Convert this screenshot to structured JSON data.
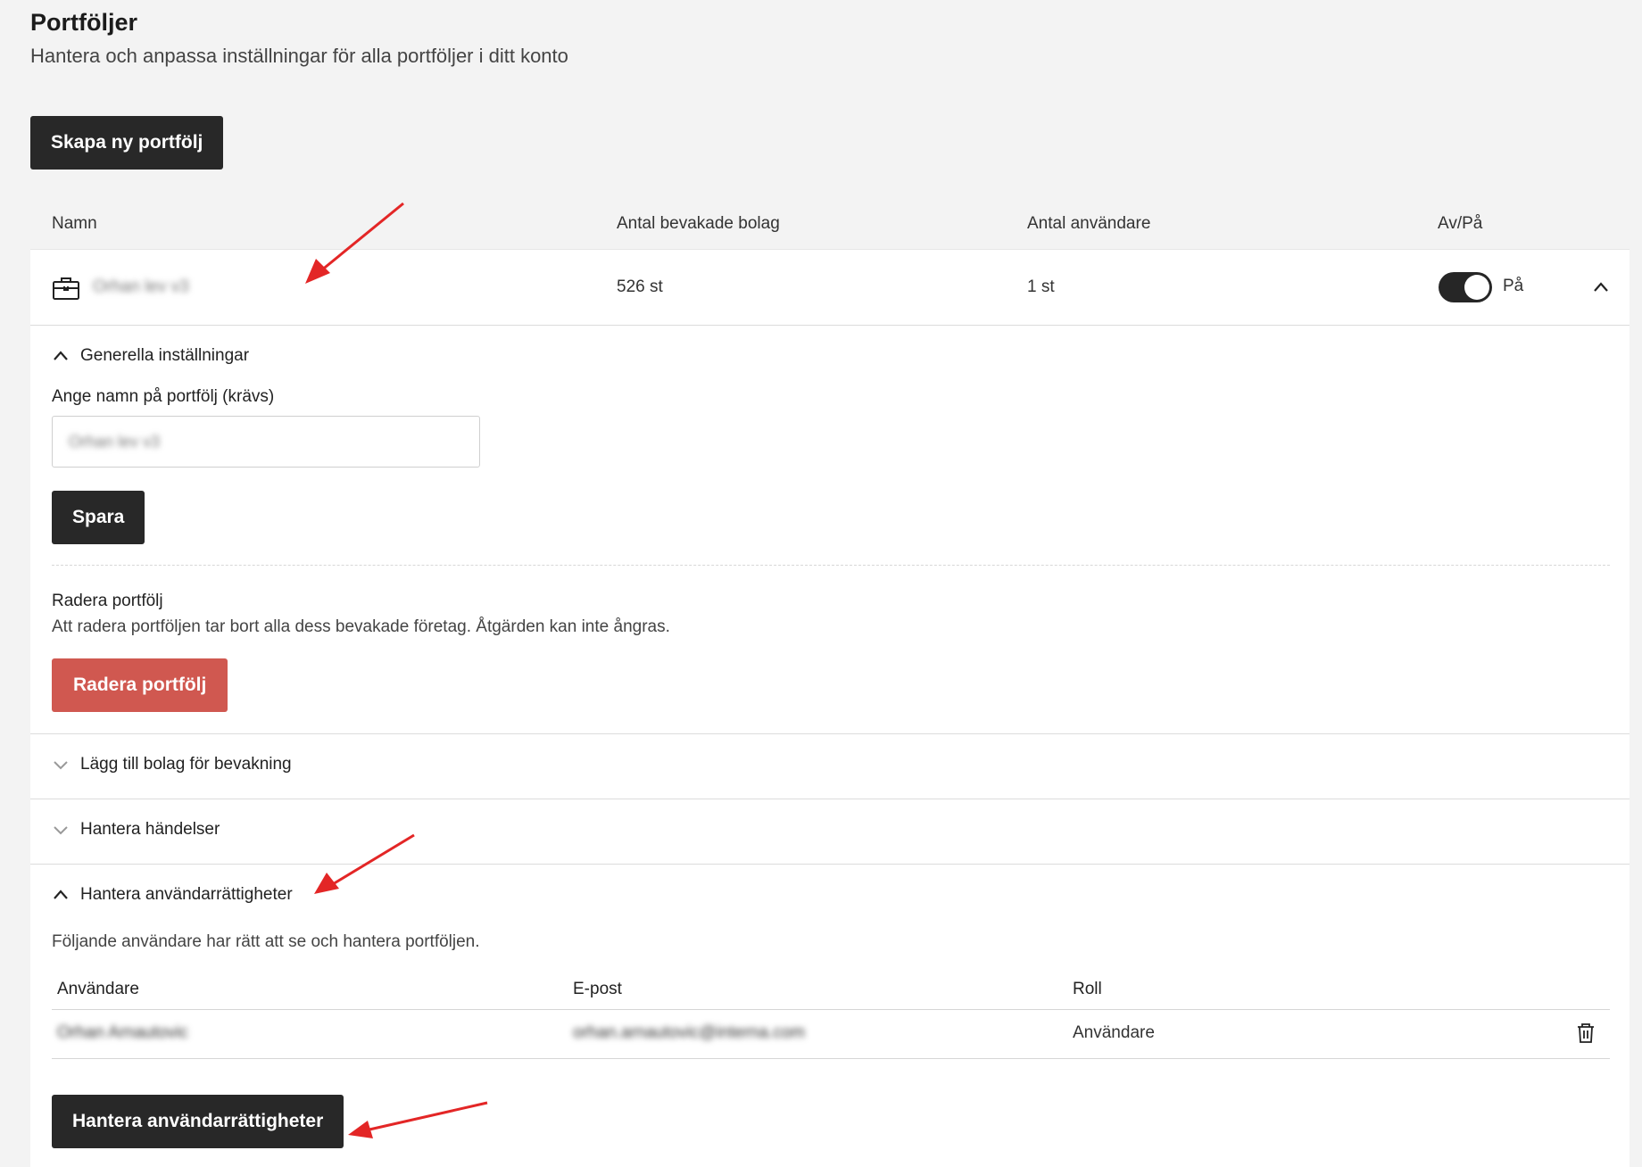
{
  "header": {
    "title": "Portföljer",
    "subtitle": "Hantera och anpassa inställningar för alla portföljer i ditt konto"
  },
  "create_button": "Skapa ny portfölj",
  "columns": {
    "name": "Namn",
    "companies": "Antal bevakade bolag",
    "users": "Antal användare",
    "toggle": "Av/På"
  },
  "portfolio": {
    "name": "Orhan lev v3",
    "companies_count": "526 st",
    "users_count": "1 st",
    "toggle_label": "På",
    "toggle_on": true,
    "icon": "briefcase-icon"
  },
  "general": {
    "title": "Generella inställningar",
    "name_label": "Ange namn på portfölj (krävs)",
    "name_value": "Orhan lev v3",
    "save_button": "Spara",
    "delete_title": "Radera portfölj",
    "delete_text": "Att radera portföljen tar bort alla dess bevakade företag. Åtgärden kan inte ångras.",
    "delete_button": "Radera portfölj"
  },
  "sections": {
    "add_companies": "Lägg till bolag för bevakning",
    "events": "Hantera händelser",
    "permissions": "Hantera användarrättigheter"
  },
  "permissions": {
    "description": "Följande användare har rätt att se och hantera portföljen.",
    "headers": {
      "user": "Användare",
      "email": "E-post",
      "role": "Roll"
    },
    "rows": [
      {
        "user": "Orhan Arnautovic",
        "email": "orhan.arnautovic@interna.com",
        "role": "Användare"
      }
    ],
    "manage_button": "Hantera användarrättigheter"
  },
  "colors": {
    "dark_button": "#282828",
    "danger_button": "#d05850",
    "background": "#f3f3f3",
    "annotation_arrow": "#e32626"
  }
}
